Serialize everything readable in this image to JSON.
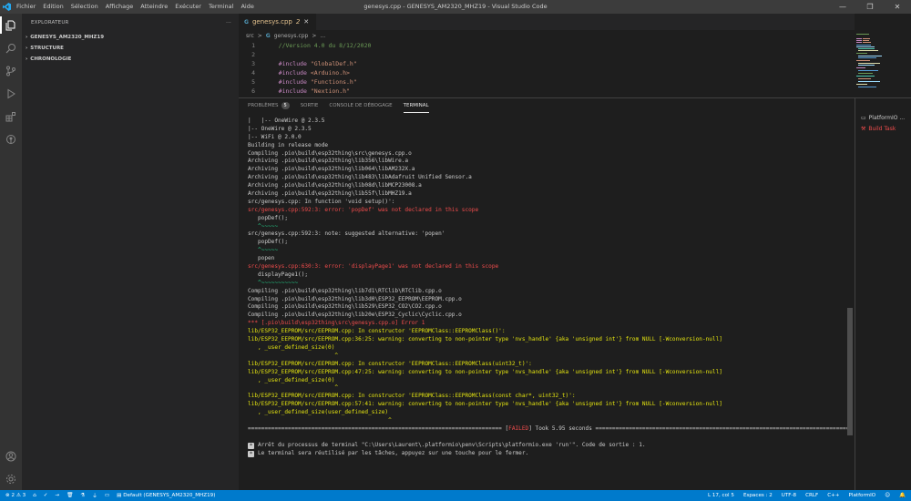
{
  "titlebar": {
    "menu": [
      "Fichier",
      "Edition",
      "Sélection",
      "Affichage",
      "Atteindre",
      "Exécuter",
      "Terminal",
      "Aide"
    ],
    "title": "genesys.cpp - GENESYS_AM2320_MHZ19 - Visual Studio Code"
  },
  "sidebar": {
    "header": "EXPLORATEUR",
    "header_more": "···",
    "sections": [
      "GENESYS_AM2320_MHZ19",
      "STRUCTURE",
      "CHRONOLOGIE"
    ]
  },
  "editor": {
    "tab_name": "genesys.cpp",
    "tab_problems": "2",
    "breadcrumb": [
      "src",
      ">",
      "genesys.cpp",
      ">",
      "..."
    ],
    "lines": [
      {
        "n": "1",
        "text": "    //Version 4.0 du 8/12/2020"
      },
      {
        "n": "2",
        "text": ""
      },
      {
        "n": "3",
        "kw": "    #include",
        "str": " \"GlobalDef.h\""
      },
      {
        "n": "4",
        "kw": "    #include",
        "str": " <Arduino.h>"
      },
      {
        "n": "5",
        "kw": "    #include",
        "str": " \"Functions.h\""
      },
      {
        "n": "6",
        "kw": "    #include",
        "str": " \"Nextion.h\""
      }
    ]
  },
  "panel": {
    "tabs": {
      "problems": "PROBLÈMES",
      "problems_count": "5",
      "output": "SORTIE",
      "debug": "CONSOLE DE DÉBOGAGE",
      "terminal": "TERMINAL"
    },
    "terminal_lines": [
      {
        "c": "t-def",
        "t": "|   |-- OneWire @ 2.3.5"
      },
      {
        "c": "t-def",
        "t": "|-- OneWire @ 2.3.5"
      },
      {
        "c": "t-def",
        "t": "|-- WiFi @ 2.0.0"
      },
      {
        "c": "t-def",
        "t": "Building in release mode"
      },
      {
        "c": "t-def",
        "t": "Compiling .pio\\build\\esp32thing\\src\\genesys.cpp.o"
      },
      {
        "c": "t-def",
        "t": "Archiving .pio\\build\\esp32thing\\lib356\\libWire.a"
      },
      {
        "c": "t-def",
        "t": "Archiving .pio\\build\\esp32thing\\lib064\\libAM232X.a"
      },
      {
        "c": "t-def",
        "t": "Archiving .pio\\build\\esp32thing\\lib483\\libAdafruit Unified Sensor.a"
      },
      {
        "c": "t-def",
        "t": "Archiving .pio\\build\\esp32thing\\lib08d\\libMCP23008.a"
      },
      {
        "c": "t-def",
        "t": "Archiving .pio\\build\\esp32thing\\lib55f\\libMHZ19.a"
      },
      {
        "c": "t-def",
        "t": "src/genesys.cpp: In function 'void setup()':"
      },
      {
        "c": "t-red",
        "t": "src/genesys.cpp:592:3: error: 'popDef' was not declared in this scope"
      },
      {
        "c": "t-def",
        "t": "   popDef();"
      },
      {
        "c": "t-green",
        "t": "   ^~~~~~"
      },
      {
        "c": "t-def",
        "t": "src/genesys.cpp:592:3: note: suggested alternative: 'popen'"
      },
      {
        "c": "t-def",
        "t": "   popDef();"
      },
      {
        "c": "t-green",
        "t": "   ^~~~~~"
      },
      {
        "c": "t-def",
        "t": "   popen"
      },
      {
        "c": "t-red",
        "t": "src/genesys.cpp:630:3: error: 'displayPage1' was not declared in this scope"
      },
      {
        "c": "t-def",
        "t": "   displayPage1();"
      },
      {
        "c": "t-green",
        "t": "   ^~~~~~~~~~~~"
      },
      {
        "c": "t-def",
        "t": "Compiling .pio\\build\\esp32thing\\lib7d1\\RTClib\\RTClib.cpp.o"
      },
      {
        "c": "t-def",
        "t": "Compiling .pio\\build\\esp32thing\\lib3d0\\ESP32_EEPROM\\EEPROM.cpp.o"
      },
      {
        "c": "t-def",
        "t": "Compiling .pio\\build\\esp32thing\\lib529\\ESP32_CO2\\CO2.cpp.o"
      },
      {
        "c": "t-def",
        "t": "Compiling .pio\\build\\esp32thing\\lib20e\\ESP32_Cyclic\\Cyclic.cpp.o"
      },
      {
        "c": "t-red",
        "t": "*** [.pio\\build\\esp32thing\\src\\genesys.cpp.o] Error 1"
      },
      {
        "c": "t-yellow",
        "t": "lib/ESP32_EEPROM/src/EEPROM.cpp: In constructor 'EEPROMClass::EEPROMClass()':"
      },
      {
        "c": "t-yellow",
        "t": "lib/ESP32_EEPROM/src/EEPROM.cpp:36:25: warning: converting to non-pointer type 'nvs_handle' {aka 'unsigned int'} from NULL [-Wconversion-null]"
      },
      {
        "c": "t-yellow",
        "t": "   , _user_defined_size(0)"
      },
      {
        "c": "t-yellow",
        "t": "                          ^"
      },
      {
        "c": "t-yellow",
        "t": "lib/ESP32_EEPROM/src/EEPROM.cpp: In constructor 'EEPROMClass::EEPROMClass(uint32_t)':"
      },
      {
        "c": "t-yellow",
        "t": "lib/ESP32_EEPROM/src/EEPROM.cpp:47:25: warning: converting to non-pointer type 'nvs_handle' {aka 'unsigned int'} from NULL [-Wconversion-null]"
      },
      {
        "c": "t-yellow",
        "t": "   , _user_defined_size(0)"
      },
      {
        "c": "t-yellow",
        "t": "                          ^"
      },
      {
        "c": "t-yellow",
        "t": "lib/ESP32_EEPROM/src/EEPROM.cpp: In constructor 'EEPROMClass::EEPROMClass(const char*, uint32_t)':"
      },
      {
        "c": "t-yellow",
        "t": "lib/ESP32_EEPROM/src/EEPROM.cpp:57:41: warning: converting to non-pointer type 'nvs_handle' {aka 'unsigned int'} from NULL [-Wconversion-null]"
      },
      {
        "c": "t-yellow",
        "t": "   , _user_defined_size(user_defined_size)"
      },
      {
        "c": "t-yellow",
        "t": "                                          ^"
      }
    ],
    "failed_left": "============================================================================ [",
    "failed_word": "FAILED",
    "failed_right": "] Took 5.95 seconds ================================================================================",
    "msg1": "Arrêt du processus de terminal \"C:\\Users\\Laurent\\.platformio\\penv\\Scripts\\platformio.exe 'run'\". Code de sortie : 1.",
    "msg2": "Le terminal sera réutilisé par les tâches, appuyez sur une touche pour le fermer.",
    "right_items": [
      "PlatformIO ...",
      "Build  Task"
    ]
  },
  "statusbar": {
    "errors": "2",
    "warnings": "3",
    "env": "Default (GENESYS_AM2320_MHZ19)",
    "position": "L 17, col 5",
    "spaces": "Espaces : 2",
    "encoding": "UTF-8",
    "eol": "CRLF",
    "language": "C++",
    "platform": "PlatformIO"
  },
  "colors": {
    "accent": "#007acc",
    "error": "#f14c4c",
    "warning": "#e5e510"
  }
}
